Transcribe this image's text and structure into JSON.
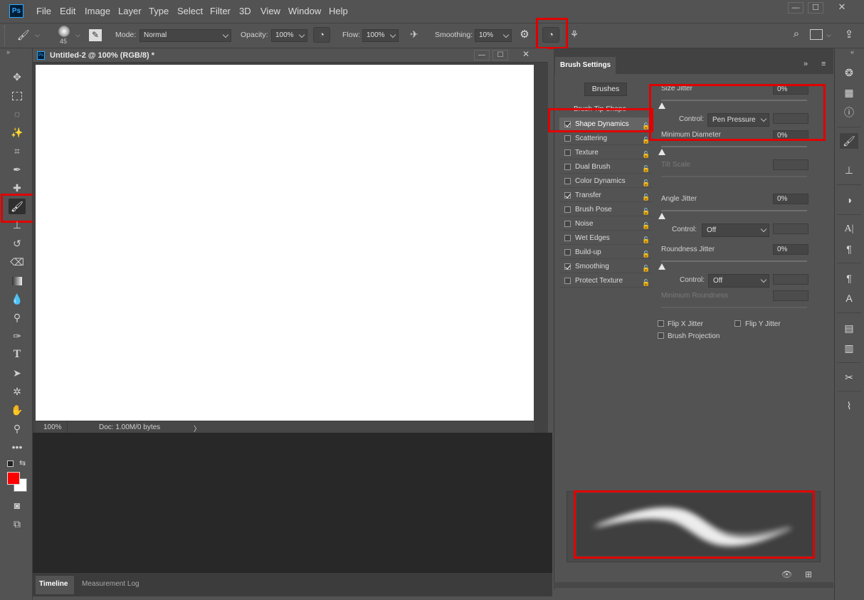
{
  "app": {
    "logo": "Ps"
  },
  "menu": [
    "File",
    "Edit",
    "Image",
    "Layer",
    "Type",
    "Select",
    "Filter",
    "3D",
    "View",
    "Window",
    "Help"
  ],
  "window_controls": {
    "minimize": "—",
    "maximize": "☐",
    "close": "✕"
  },
  "options_bar": {
    "brush_size": "45",
    "mode_label": "Mode:",
    "mode_value": "Normal",
    "opacity_label": "Opacity:",
    "opacity_value": "100%",
    "flow_label": "Flow:",
    "flow_value": "100%",
    "smoothing_label": "Smoothing:",
    "smoothing_value": "10%"
  },
  "document": {
    "tab_title": "Untitled-2 @ 100% (RGB/8) *",
    "zoom": "100%",
    "doc_info": "Doc: 1.00M/0 bytes"
  },
  "bottom_tabs": [
    "Timeline",
    "Measurement Log"
  ],
  "panel": {
    "tab_title": "Brush Settings",
    "brushes_button": "Brushes",
    "brush_tip_shape": "Brush Tip Shape",
    "list": [
      {
        "label": "Shape Dynamics",
        "checked": true,
        "selected": true
      },
      {
        "label": "Scattering",
        "checked": false
      },
      {
        "label": "Texture",
        "checked": false
      },
      {
        "label": "Dual Brush",
        "checked": false
      },
      {
        "label": "Color Dynamics",
        "checked": false
      },
      {
        "label": "Transfer",
        "checked": true
      },
      {
        "label": "Brush Pose",
        "checked": false
      },
      {
        "label": "Noise",
        "checked": false
      },
      {
        "label": "Wet Edges",
        "checked": false
      },
      {
        "label": "Build-up",
        "checked": false
      },
      {
        "label": "Smoothing",
        "checked": true
      },
      {
        "label": "Protect Texture",
        "checked": false
      }
    ],
    "size_jitter_label": "Size Jitter",
    "size_jitter_value": "0%",
    "control_label": "Control:",
    "size_control_value": "Pen Pressure",
    "min_diameter_label": "Minimum Diameter",
    "min_diameter_value": "0%",
    "tilt_scale_label": "Tilt Scale",
    "angle_jitter_label": "Angle Jitter",
    "angle_jitter_value": "0%",
    "angle_control_value": "Off",
    "roundness_jitter_label": "Roundness Jitter",
    "roundness_jitter_value": "0%",
    "roundness_control_value": "Off",
    "min_roundness_label": "Minimum Roundness",
    "flip_x_label": "Flip X Jitter",
    "flip_y_label": "Flip Y Jitter",
    "brush_projection_label": "Brush Projection"
  },
  "colors": {
    "foreground": "#ff0000",
    "background": "#ffffff",
    "highlight": "#e00000"
  }
}
